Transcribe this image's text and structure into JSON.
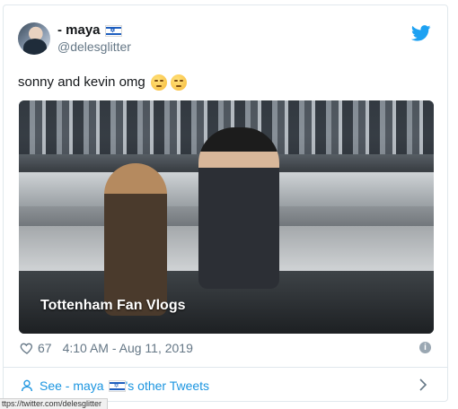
{
  "tweet": {
    "display_name": "- maya",
    "flag_icon": "israel-flag-icon",
    "handle": "@delesglitter",
    "text": "sonny and kevin omg",
    "emojis": [
      "face-with-rolling-eyes-emoji",
      "face-with-rolling-eyes-emoji"
    ],
    "video_caption": "Tottenham Fan Vlogs",
    "likes": "67",
    "timestamp": "4:10 AM - Aug 11, 2019"
  },
  "footer": {
    "see_prefix": "See - maya",
    "see_suffix": "'s other Tweets"
  },
  "status_bar": {
    "url": "ttps://twitter.com/delesglitter"
  },
  "colors": {
    "link": "#1b95e0",
    "muted": "#657786",
    "border": "#e1e8ed"
  }
}
